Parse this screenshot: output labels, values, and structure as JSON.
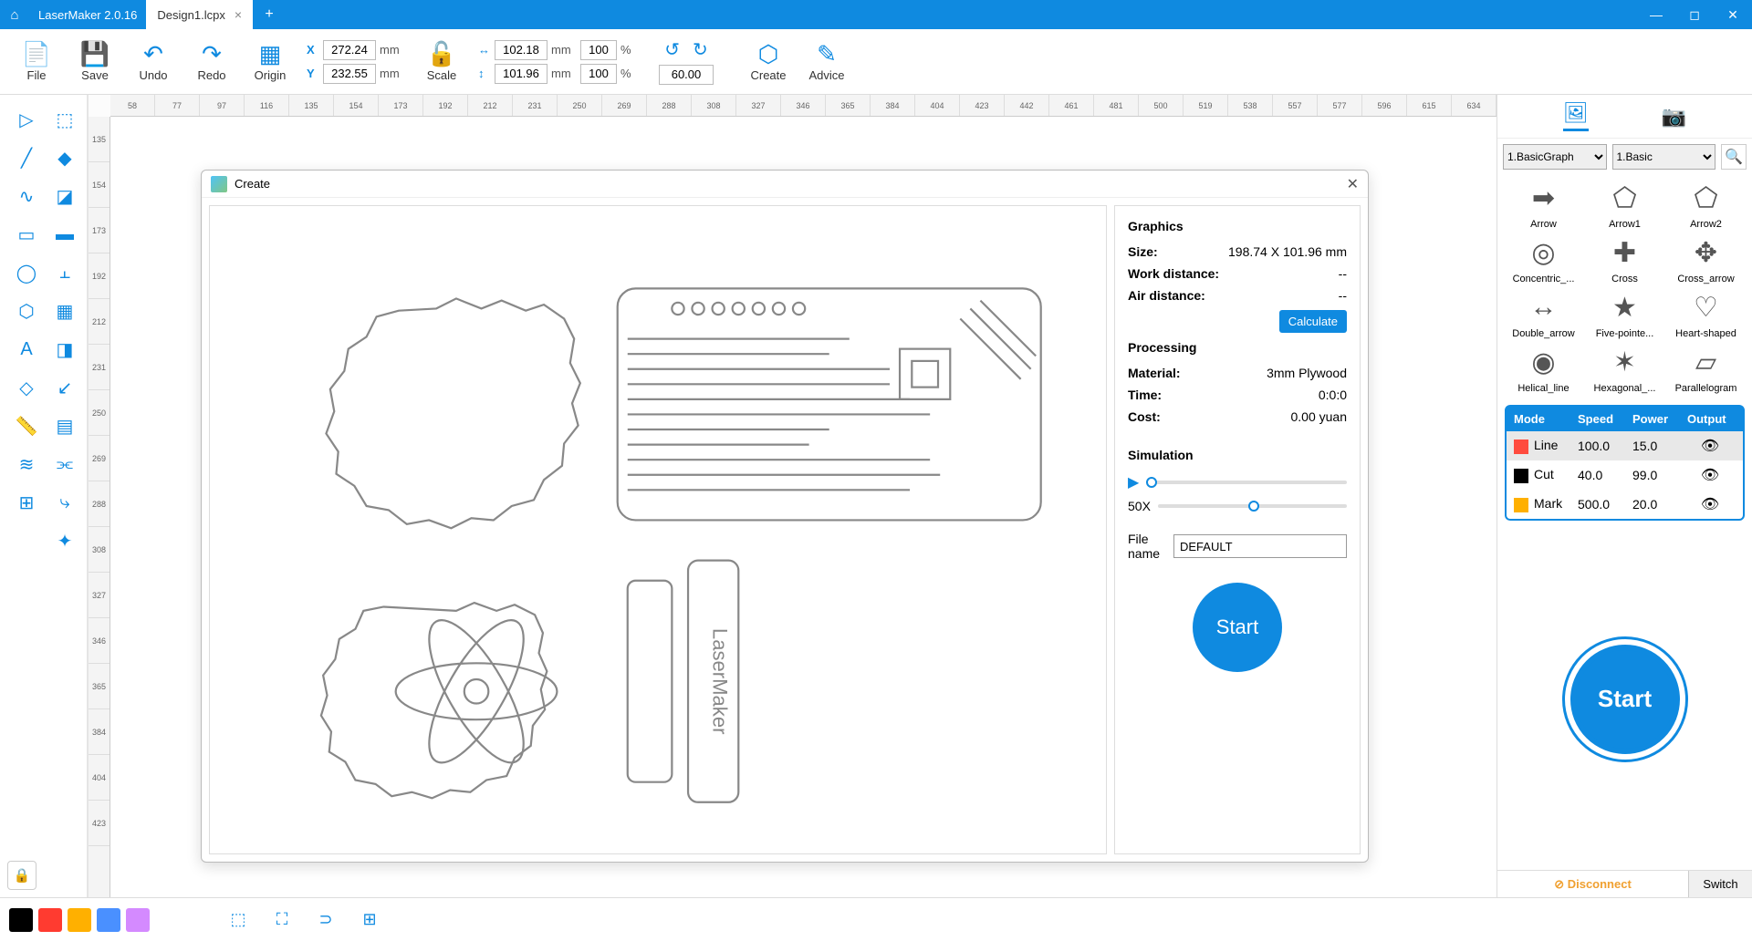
{
  "app": {
    "name": "LaserMaker 2.0.16",
    "tab": "Design1.lcpx"
  },
  "toolbar": {
    "file": "File",
    "save": "Save",
    "undo": "Undo",
    "redo": "Redo",
    "origin": "Origin",
    "x": "272.24",
    "y": "232.55",
    "mm": "mm",
    "scale": "Scale",
    "w": "102.18",
    "h": "101.96",
    "wp": "100",
    "hp": "100",
    "pct": "%",
    "rot": "60.00",
    "create": "Create",
    "advice": "Advice"
  },
  "dialog": {
    "title": "Create",
    "graphics": "Graphics",
    "size_k": "Size:",
    "size_v": "198.74 X 101.96 mm",
    "workdist_k": "Work distance:",
    "workdist_v": "--",
    "airdist_k": "Air distance:",
    "airdist_v": "--",
    "calc": "Calculate",
    "processing": "Processing",
    "material_k": "Material:",
    "material_v": "3mm Plywood",
    "time_k": "Time:",
    "time_v": "0:0:0",
    "cost_k": "Cost:",
    "cost_v": "0.00 yuan",
    "simulation": "Simulation",
    "speed": "50X",
    "filename_k": "File name",
    "filename_v": "DEFAULT",
    "start": "Start"
  },
  "library": {
    "cat1": "1.BasicGraph",
    "cat2": "1.Basic",
    "shapes": [
      "Arrow",
      "Arrow1",
      "Arrow2",
      "Concentric_...",
      "Cross",
      "Cross_arrow",
      "Double_arrow",
      "Five-pointe...",
      "Heart-shaped",
      "Helical_line",
      "Hexagonal_...",
      "Parallelogram"
    ]
  },
  "layers": {
    "headers": {
      "mode": "Mode",
      "speed": "Speed",
      "power": "Power",
      "output": "Output"
    },
    "rows": [
      {
        "color": "#ff4b3e",
        "name": "Line",
        "speed": "100.0",
        "power": "15.0"
      },
      {
        "color": "#000000",
        "name": "Cut",
        "speed": "40.0",
        "power": "99.0"
      },
      {
        "color": "#ffb000",
        "name": "Mark",
        "speed": "500.0",
        "power": "20.0"
      }
    ]
  },
  "start": "Start",
  "footer": {
    "disconnect": "Disconnect",
    "switch": "Switch"
  },
  "palette": [
    "#000000",
    "#ff3b30",
    "#ffb000",
    "#4a90ff",
    "#d48aff"
  ],
  "ruler_h": [
    58,
    77,
    97,
    116,
    135,
    154,
    173,
    192,
    212,
    231,
    250,
    269,
    288,
    308,
    327,
    346,
    365,
    384,
    404,
    423,
    442,
    461,
    481,
    500,
    519,
    538,
    557,
    577,
    596,
    615,
    634
  ],
  "ruler_v": [
    135,
    154,
    173,
    192,
    212,
    231,
    250,
    269,
    288,
    308,
    327,
    346,
    365,
    384,
    404,
    423
  ]
}
